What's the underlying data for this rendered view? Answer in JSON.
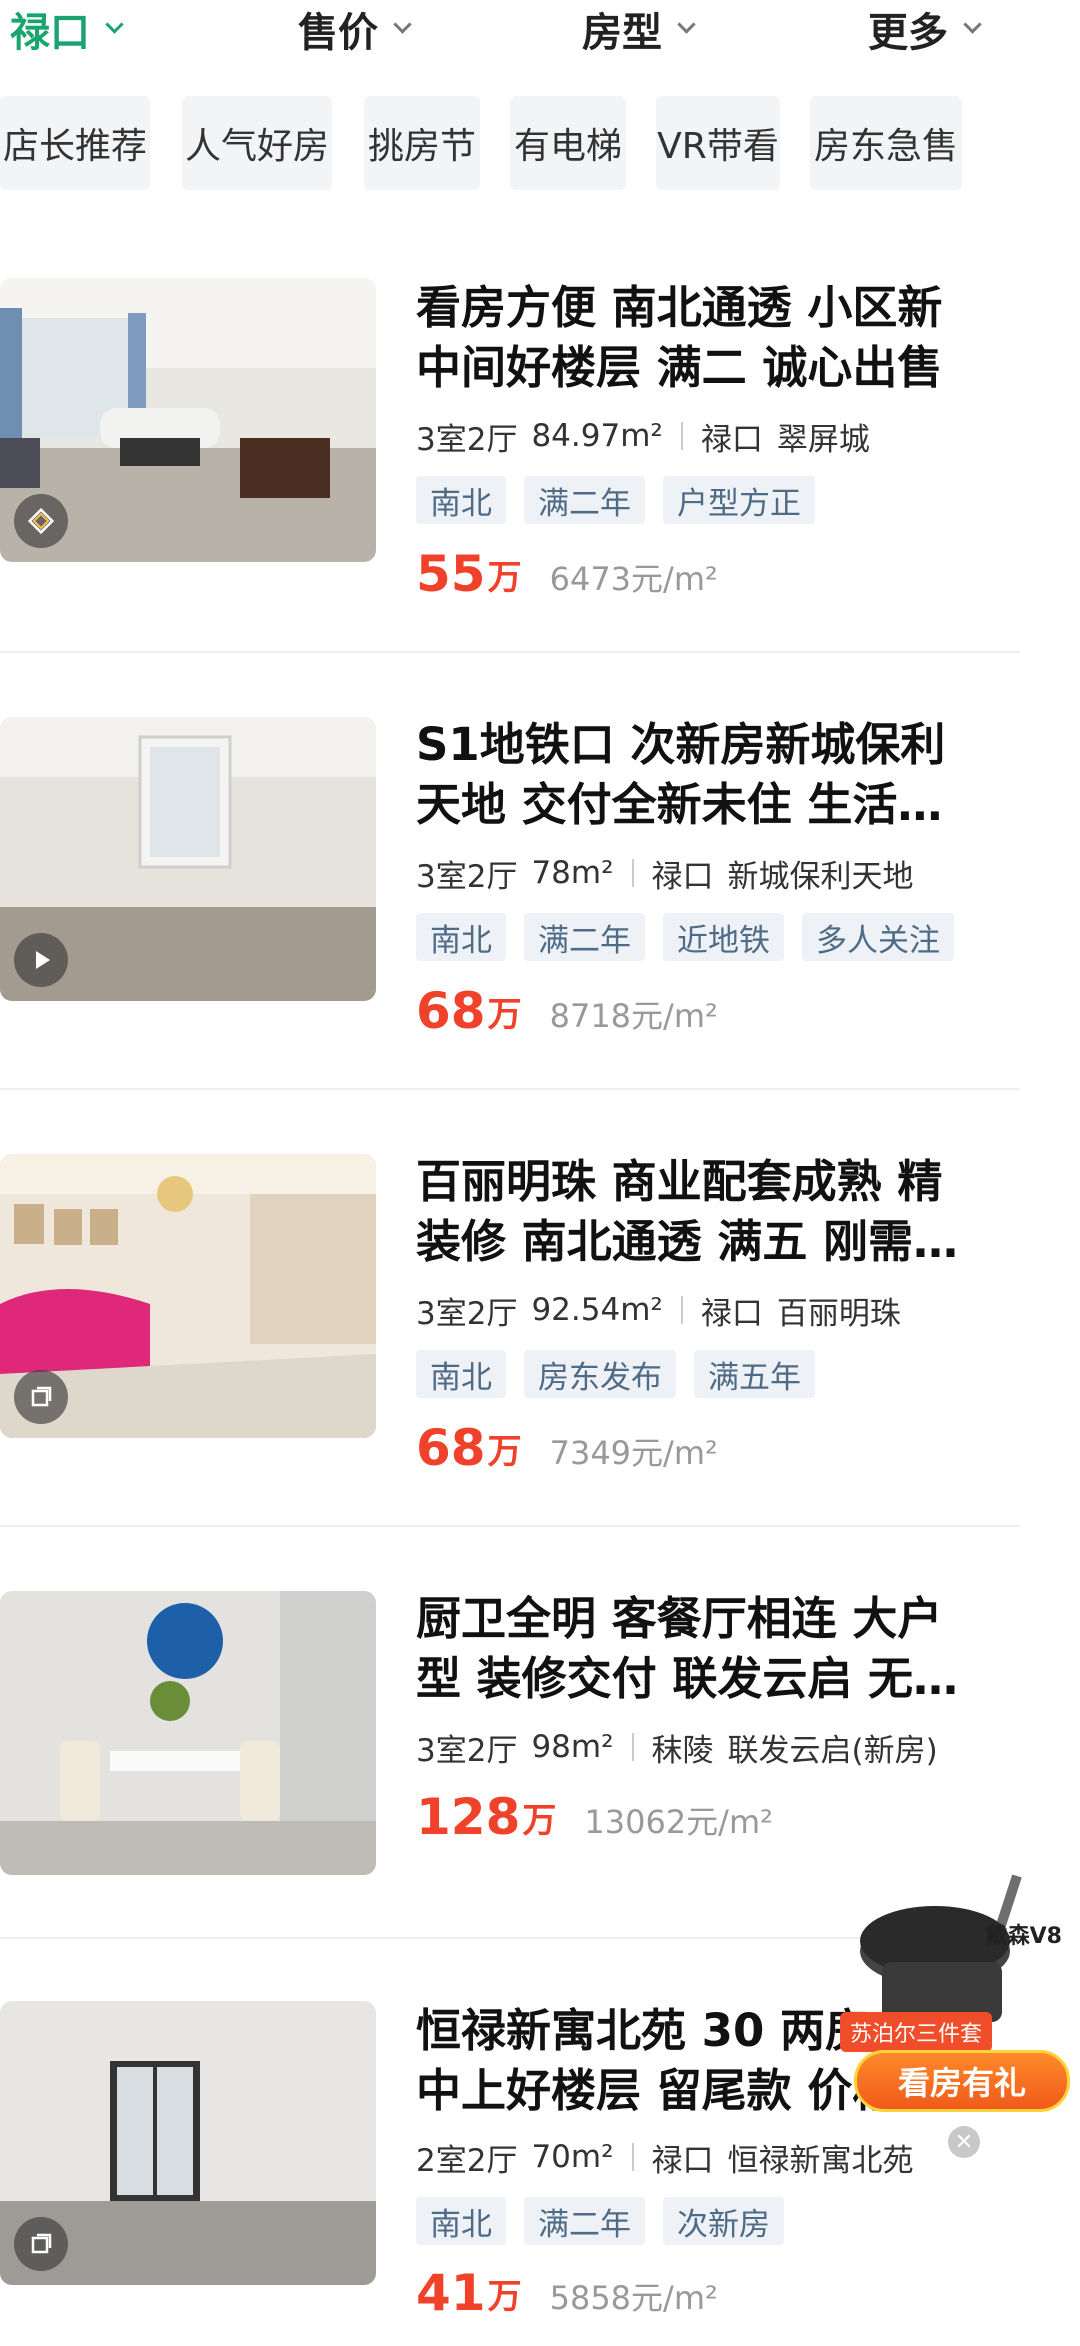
{
  "filters": [
    {
      "label": "禄口",
      "active": true
    },
    {
      "label": "售价",
      "active": false
    },
    {
      "label": "房型",
      "active": false
    },
    {
      "label": "更多",
      "active": false
    }
  ],
  "chips": [
    "店长推荐",
    "人气好房",
    "挑房节",
    "有电梯",
    "VR带看",
    "房东急售"
  ],
  "listings": [
    {
      "title_lines": [
        "看房方便 南北通透 小区新",
        "中间好楼层 满二 诚心出售"
      ],
      "layout": "3室2厅",
      "area": "84.97m²",
      "district": "禄口",
      "community": "翠屏城",
      "tags": [
        "南北",
        "满二年",
        "户型方正"
      ],
      "price": "55",
      "price_unit": "万",
      "unit_price": "6473元/m²",
      "badge_icon": "vr-icon"
    },
    {
      "title_lines": [
        "S1地铁口 次新房新城保利",
        "天地 交付全新未住 生活…"
      ],
      "layout": "3室2厅",
      "area": "78m²",
      "district": "禄口",
      "community": "新城保利天地",
      "tags": [
        "南北",
        "满二年",
        "近地铁",
        "多人关注"
      ],
      "price": "68",
      "price_unit": "万",
      "unit_price": "8718元/m²",
      "badge_icon": "play-icon"
    },
    {
      "title_lines": [
        "百丽明珠 商业配套成熟 精",
        "装修 南北通透 满五 刚需…"
      ],
      "layout": "3室2厅",
      "area": "92.54m²",
      "district": "禄口",
      "community": "百丽明珠",
      "tags": [
        "南北",
        "房东发布",
        "满五年"
      ],
      "price": "68",
      "price_unit": "万",
      "unit_price": "7349元/m²",
      "badge_icon": "3d-icon"
    },
    {
      "title_lines": [
        "厨卫全明 客餐厅相连 大户",
        "型 装修交付 联发云启 无…"
      ],
      "layout": "3室2厅",
      "area": "98m²",
      "district": "秣陵",
      "community": "联发云启(新房)",
      "tags": [],
      "price": "128",
      "price_unit": "万",
      "unit_price": "13062元/m²",
      "badge_icon": ""
    },
    {
      "title_lines": [
        "恒禄新寓北苑 30 两房",
        "中上好楼层 留尾款 价格"
      ],
      "layout": "2室2厅",
      "area": "70m²",
      "district": "禄口",
      "community": "恒禄新寓北苑",
      "tags": [
        "南北",
        "满二年",
        "次新房"
      ],
      "price": "41",
      "price_unit": "万",
      "unit_price": "5858元/m²",
      "badge_icon": "3d-icon"
    }
  ],
  "promo": {
    "brand": "戴森V8",
    "subtitle": "苏泊尔三件套",
    "cta": "看房有礼",
    "close_icon": "close-icon"
  }
}
